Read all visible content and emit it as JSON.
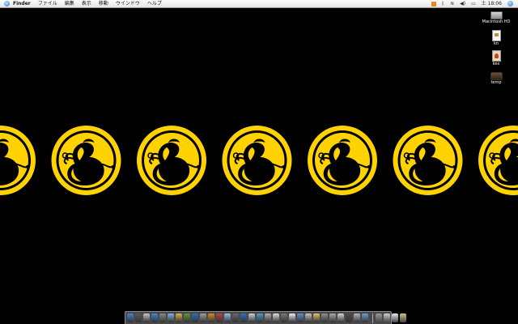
{
  "menubar": {
    "app_name": "Finder",
    "items": [
      "ファイル",
      "編集",
      "表示",
      "移動",
      "ウインドウ",
      "ヘルプ"
    ],
    "clock": "土 18:06"
  },
  "desktop_icons": [
    {
      "label": "Macintosh HD",
      "icon": "hard-disk-icon"
    },
    {
      "label": "kn",
      "icon": "document-icon"
    },
    {
      "label": "kex",
      "icon": "image-file-icon"
    },
    {
      "label": "temp",
      "icon": "folder-box-icon"
    }
  ],
  "wallpaper": {
    "motif": "yellow-crest-on-black",
    "background_color": "#000000",
    "crest_color": "#ffd200",
    "crest_count": 7
  },
  "dock": {
    "app_icons": [
      "#4b7fd0",
      "#5a5a5a",
      "#c9c9c9",
      "#3a8ad8",
      "#8a8a8a",
      "#7fb2e6",
      "#e3b04a",
      "#5b9a3c",
      "#2f6fc4",
      "#a0a0a0",
      "#d88a2b",
      "#c04040",
      "#9cc0ea",
      "#6a6a6a",
      "#3070c0",
      "#d0d0d0",
      "#4c9ad8",
      "#b0b0b0",
      "#e0e0e0",
      "#7a7a7a",
      "#f2f2f2",
      "#5e8ed0",
      "#c8c8c8",
      "#e8c060",
      "#909090",
      "#a8a8a8",
      "#d6d6d6",
      "#4a4a4a",
      "#b8b8b8",
      "#6aa0d8"
    ],
    "doc_icons": [
      "#9a9a9a",
      "#cfcfcf",
      "#e8e8e8",
      "#d4c080"
    ]
  }
}
